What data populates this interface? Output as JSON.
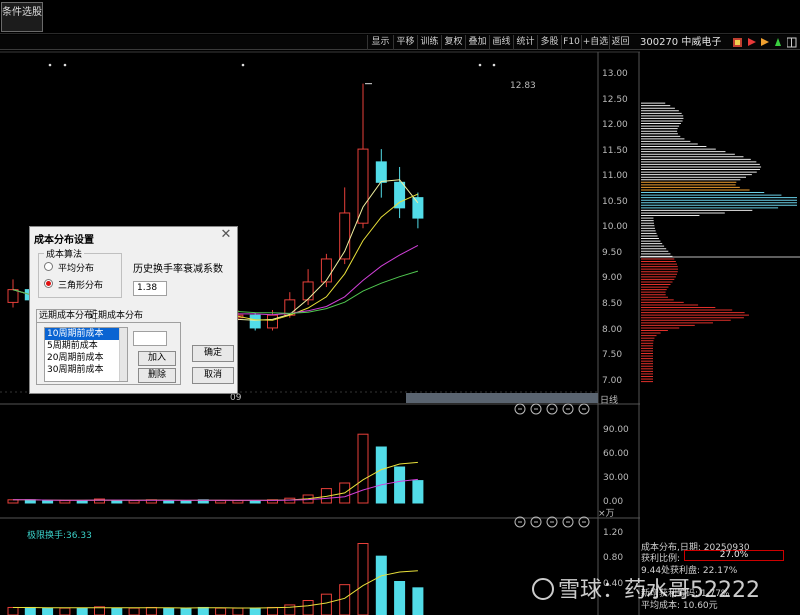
{
  "top_tab": "条件选股",
  "toolbar": {
    "buttons": [
      "显示",
      "平移",
      "训练",
      "复权",
      "叠加",
      "画线",
      "统计",
      "多股",
      "F10",
      "+自选",
      "返回"
    ],
    "stock_title": "300270 中威电子"
  },
  "price_axis": [
    "13.00",
    "12.50",
    "12.00",
    "11.50",
    "11.00",
    "10.50",
    "10.00",
    "9.50",
    "9.00",
    "8.50",
    "8.00",
    "7.50",
    "7.00"
  ],
  "high_label": "12.83",
  "date_label": "09",
  "period_label": "日线",
  "volume_axis": [
    "90.00",
    "60.00",
    "30.00",
    "0.00"
  ],
  "volume_unit": "×万",
  "turnover_axis": [
    "1.20",
    "0.80",
    "0.40"
  ],
  "turnover_label": "极限换手:36.33",
  "panel_tool_icons": [
    "help-icon",
    "zoom-in-icon",
    "settings-icon",
    "swap-icon",
    "close-icon"
  ],
  "chip_info": {
    "date_line": "成本分布,日期: 20250930",
    "profit_ratio_label": "获利比例:",
    "profit_ratio_value": "27.0%",
    "line2": "9.44处获利盘: 22.17%",
    "line3": "新增获利筹码: 1.77%",
    "line4": "平均成本: 10.60元"
  },
  "watermark": "雪球：药水哥52222",
  "dialog": {
    "title": "成本分布设置",
    "group_title": "成本算法",
    "radio_options": [
      "平均分布",
      "三角形分布"
    ],
    "selected_radio": 1,
    "decay_label": "历史换手率衰减系数",
    "decay_value": "1.38",
    "tabs": [
      "远期成本分布",
      "近期成本分布"
    ],
    "list_items": [
      "10周期前成本",
      "5周期前成本",
      "20周期前成本",
      "30周期前成本"
    ],
    "selected_item": 0,
    "period_input": "",
    "buttons": {
      "add": "加入",
      "delete": "删除",
      "ok": "确定",
      "cancel": "取消"
    }
  },
  "colors": {
    "up": "#e8403a",
    "down": "#52dce8",
    "ma5": "#f0f0a0",
    "ma10": "#e8e03a",
    "ma20": "#d040d8",
    "ma30": "#50c850"
  },
  "chart_data": {
    "type": "candlestick",
    "title": "",
    "ylim": [
      7.0,
      13.0
    ],
    "series": [
      {
        "open": 8.55,
        "close": 8.8,
        "high": 9.0,
        "low": 8.45
      },
      {
        "open": 8.8,
        "close": 8.6,
        "high": 8.9,
        "low": 8.5
      },
      {
        "open": 8.4,
        "close": 8.25,
        "high": 8.5,
        "low": 8.2
      },
      {
        "open": 8.2,
        "close": 8.3,
        "high": 8.4,
        "low": 8.15
      },
      {
        "open": 8.15,
        "close": 8.05,
        "high": 8.25,
        "low": 8.0
      },
      {
        "open": 8.2,
        "close": 8.45,
        "high": 8.55,
        "low": 8.1
      },
      {
        "open": 8.4,
        "close": 8.35,
        "high": 8.5,
        "low": 8.3
      },
      {
        "open": 8.35,
        "close": 8.45,
        "high": 8.5,
        "low": 8.25
      },
      {
        "open": 8.4,
        "close": 8.55,
        "high": 8.6,
        "low": 8.3
      },
      {
        "open": 8.55,
        "close": 8.4,
        "high": 8.6,
        "low": 8.35
      },
      {
        "open": 8.4,
        "close": 8.35,
        "high": 8.45,
        "low": 8.25
      },
      {
        "open": 8.3,
        "close": 8.1,
        "high": 8.4,
        "low": 8.05
      },
      {
        "open": 8.1,
        "close": 8.25,
        "high": 8.35,
        "low": 8.05
      },
      {
        "open": 8.25,
        "close": 8.3,
        "high": 8.4,
        "low": 8.2
      },
      {
        "open": 8.3,
        "close": 8.05,
        "high": 8.35,
        "low": 8.0
      },
      {
        "open": 8.05,
        "close": 8.3,
        "high": 8.4,
        "low": 8.0
      },
      {
        "open": 8.3,
        "close": 8.6,
        "high": 8.75,
        "low": 8.25
      },
      {
        "open": 8.6,
        "close": 8.95,
        "high": 9.2,
        "low": 8.5
      },
      {
        "open": 8.95,
        "close": 9.4,
        "high": 9.5,
        "low": 8.85
      },
      {
        "open": 9.4,
        "close": 10.3,
        "high": 10.8,
        "low": 9.3
      },
      {
        "open": 10.1,
        "close": 11.55,
        "high": 12.83,
        "low": 10.0
      },
      {
        "open": 11.3,
        "close": 10.9,
        "high": 11.55,
        "low": 10.6
      },
      {
        "open": 10.9,
        "close": 10.4,
        "high": 11.2,
        "low": 10.2
      },
      {
        "open": 10.6,
        "close": 10.2,
        "high": 10.7,
        "low": 10.0
      }
    ],
    "volume": [
      4,
      4,
      3,
      3,
      3,
      5,
      3,
      3,
      4,
      3,
      3,
      4,
      3,
      3,
      3,
      4,
      6,
      10,
      18,
      25,
      86,
      70,
      45,
      28
    ],
    "turnover": [
      0.04,
      0.04,
      0.03,
      0.03,
      0.03,
      0.05,
      0.03,
      0.03,
      0.04,
      0.03,
      0.03,
      0.04,
      0.03,
      0.03,
      0.03,
      0.04,
      0.08,
      0.15,
      0.25,
      0.4,
      1.05,
      0.85,
      0.45,
      0.35
    ]
  }
}
